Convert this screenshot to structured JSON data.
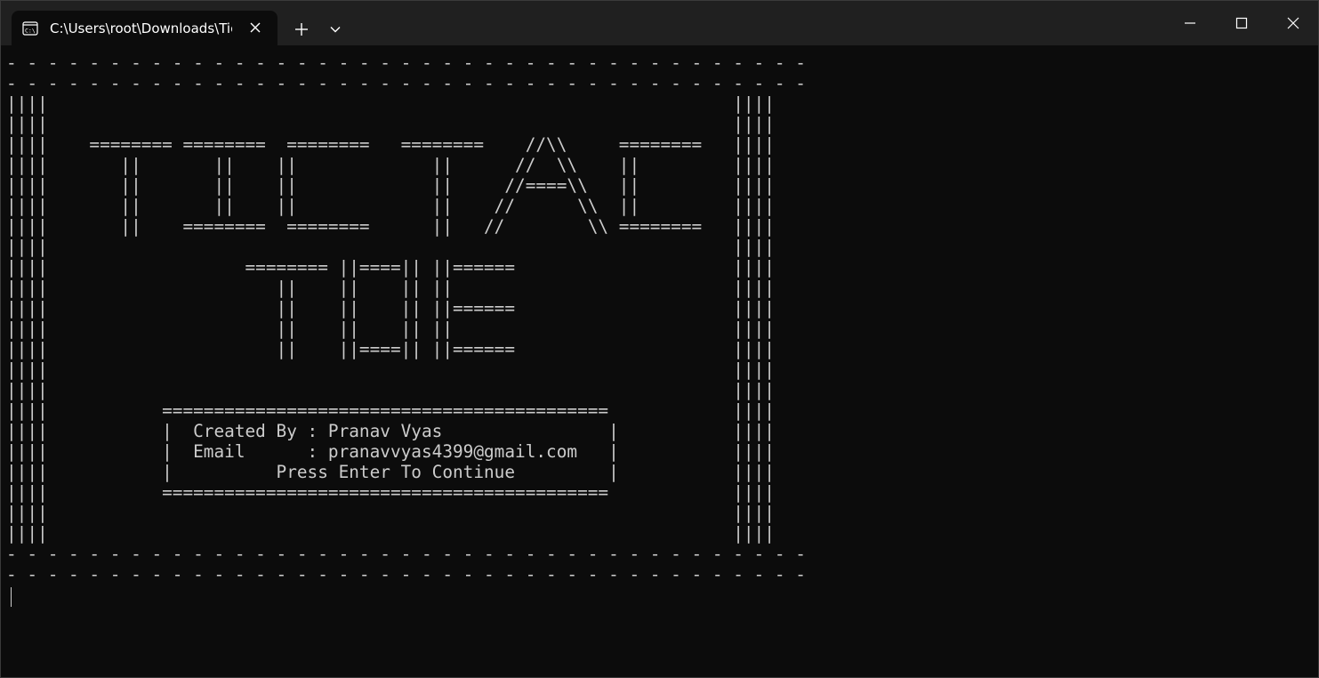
{
  "window": {
    "tab_title": "C:\\Users\\root\\Downloads\\Tic",
    "tab_icon": "terminal-cmd-icon"
  },
  "colors": {
    "titlebar": "#202020",
    "background": "#0c0c0c",
    "text": "#cccccc"
  },
  "terminal": {
    "lines": [
      "- - - - - - - - - - - - - - - - - - - - - - - - - - - - - - - - - - - - - - -",
      "- - - - - - - - - - - - - - - - - - - - - - - - - - - - - - - - - - - - - - -",
      "||||                                                                  ||||",
      "||||                                                                  ||||",
      "||||    ======== ========  ========   ========    //\\\\     ========   ||||",
      "||||       ||       ||    ||             ||      //  \\\\    ||         ||||",
      "||||       ||       ||    ||             ||     //====\\\\   ||         ||||",
      "||||       ||       ||    ||             ||    //      \\\\  ||         ||||",
      "||||       ||    ========  ========      ||   //        \\\\ ========   ||||",
      "||||                                                                  ||||",
      "||||                   ======== ||====|| ||======                     ||||",
      "||||                      ||    ||    || ||                           ||||",
      "||||                      ||    ||    || ||======                     ||||",
      "||||                      ||    ||    || ||                           ||||",
      "||||                      ||    ||====|| ||======                     ||||",
      "||||                                                                  ||||",
      "||||                                                                  ||||",
      "||||           ===========================================            ||||",
      "||||           |  Created By : Pranav Vyas                |           ||||",
      "||||           |  Email      : pranavvyas4399@gmail.com   |           ||||",
      "||||           |          Press Enter To Continue         |           ||||",
      "||||           ===========================================            ||||",
      "||||                                                                  ||||",
      "||||                                                                  ||||",
      "- - - - - - - - - - - - - - - - - - - - - - - - - - - - - - - - - - - - - - -",
      "- - - - - - - - - - - - - - - - - - - - - - - - - - - - - - - - - - - - - - -"
    ]
  }
}
